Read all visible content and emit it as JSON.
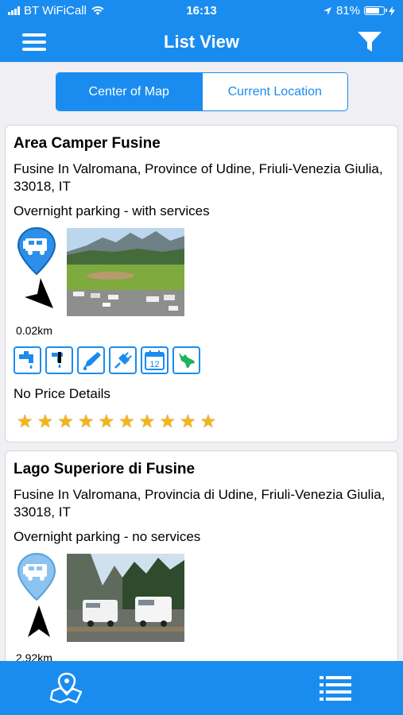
{
  "status": {
    "carrier": "BT WiFiCall",
    "time": "16:13",
    "battery_text": "81%",
    "battery_level": 0.81
  },
  "nav": {
    "title": "List View",
    "menu_icon": "hamburger-menu-icon",
    "filter_icon": "filter-icon"
  },
  "segment": {
    "options": [
      "Center of Map",
      "Current Location"
    ],
    "selected": "Center of Map"
  },
  "listings": [
    {
      "name": "Area Camper Fusine",
      "address": "Fusine In Valromana, Province of Udine, Friuli-Venezia Giulia, 33018, IT",
      "parking_type": "Overnight parking - with services",
      "distance": "0.02km",
      "amenities": [
        "water-tap-icon",
        "drain-icon",
        "toilet-dump-icon",
        "electricity-icon",
        "calendar-icon",
        "pets-icon"
      ],
      "price": "No Price Details",
      "rating": 9.5,
      "rating_max": 10
    },
    {
      "name": "Lago Superiore di Fusine",
      "address": "Fusine In Valromana, Provincia di Udine, Friuli-Venezia Giulia, 33018, IT",
      "parking_type": "Overnight parking - no services",
      "distance": "2.92km"
    }
  ],
  "amenity_day_number": "12",
  "tabs": {
    "map_icon": "map-pin-icon",
    "list_icon": "list-icon"
  },
  "colors": {
    "accent": "#1a8cf0",
    "star": "#f4b41a"
  }
}
